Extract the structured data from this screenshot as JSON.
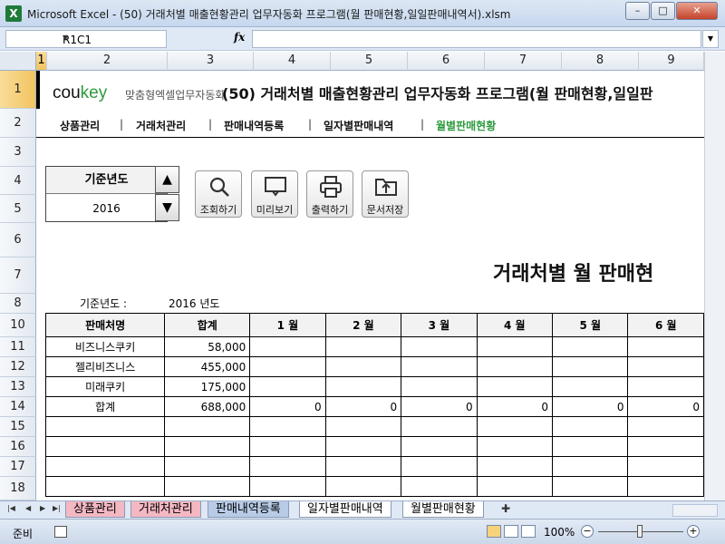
{
  "window": {
    "title": "Microsoft Excel - (50) 거래처별 매출현황관리 업무자동화 프로그램(월 판매현황,일일판매내역서).xlsm",
    "app_icon": "X",
    "minimize": "–",
    "maximize": "□",
    "close": "✕"
  },
  "formula_bar": {
    "name_box": "R1C1",
    "fx": "fx",
    "content": ""
  },
  "columns": [
    "1",
    "2",
    "3",
    "4",
    "5",
    "6",
    "7",
    "8",
    "9"
  ],
  "rows": [
    "1",
    "2",
    "3",
    "4",
    "5",
    "6",
    "7",
    "8",
    "10",
    "11",
    "12",
    "13",
    "14",
    "15",
    "16",
    "17",
    "18"
  ],
  "header": {
    "logo_brand_a": "cou",
    "logo_brand_b": "key",
    "logo_sub": "맞춤형엑셀업무자동화",
    "title": "(50) 거래처별 매출현황관리 업무자동화 프로그램(월 판매현황,일일판"
  },
  "menu": {
    "items": [
      "상품관리",
      "거래처관리",
      "판매내역등록",
      "일자별판매내역",
      "월별판매현황"
    ],
    "separator": "|",
    "active_color": "#2d9b3e"
  },
  "controls": {
    "year_label": "기준년도",
    "year_value": "2016",
    "spin_up": "▲",
    "spin_down": "▼",
    "buttons": [
      {
        "label": "조회하기",
        "icon": "search-icon"
      },
      {
        "label": "미리보기",
        "icon": "monitor-icon"
      },
      {
        "label": "출력하기",
        "icon": "printer-icon"
      },
      {
        "label": "문서저장",
        "icon": "folder-upload-icon"
      }
    ]
  },
  "report": {
    "title": "거래처별 월 판매현",
    "base_year_label": "기준년도 :",
    "base_year_value": "2016 년도",
    "headers": [
      "판매처명",
      "합계",
      "1 월",
      "2 월",
      "3 월",
      "4 월",
      "5 월",
      "6 월"
    ],
    "rows": [
      [
        "비즈니스쿠키",
        "58,000",
        "",
        "",
        "",
        "",
        "",
        ""
      ],
      [
        "젤리비즈니스",
        "455,000",
        "",
        "",
        "",
        "",
        "",
        ""
      ],
      [
        "미래쿠키",
        "175,000",
        "",
        "",
        "",
        "",
        "",
        ""
      ],
      [
        "합계",
        "688,000",
        "0",
        "0",
        "0",
        "0",
        "0",
        "0"
      ],
      [
        "",
        "",
        "",
        "",
        "",
        "",
        "",
        ""
      ],
      [
        "",
        "",
        "",
        "",
        "",
        "",
        "",
        ""
      ],
      [
        "",
        "",
        "",
        "",
        "",
        "",
        "",
        ""
      ],
      [
        "",
        "",
        "",
        "",
        "",
        "",
        "",
        ""
      ]
    ]
  },
  "sheet_tabs": [
    {
      "label": "상품관리",
      "color": "#f4b8c2"
    },
    {
      "label": "거래처관리",
      "color": "#f4b8c2"
    },
    {
      "label": "판매내역등록",
      "color": "#b8cce8"
    },
    {
      "label": "일자별판매내역",
      "color": "#ffffff"
    },
    {
      "label": "월별판매현황",
      "color": "#ffffff"
    }
  ],
  "status": {
    "ready": "준비",
    "zoom": "100%",
    "zoom_minus": "−",
    "zoom_plus": "+"
  }
}
